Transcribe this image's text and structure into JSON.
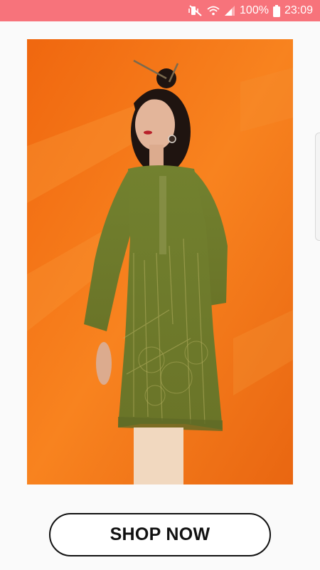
{
  "status_bar": {
    "battery_percent": "100%",
    "time": "23:09",
    "background_color": "#f7737b",
    "icons": [
      "mute-vibrate-icon",
      "wifi-icon",
      "cellular-signal-icon",
      "battery-icon"
    ]
  },
  "product": {
    "image_subject": "model wearing an olive green embroidered kurta against an orange backdrop",
    "backdrop_color": "#f27a1c",
    "garment_color": "#6f7a2e"
  },
  "cta": {
    "label": "SHOP NOW"
  }
}
